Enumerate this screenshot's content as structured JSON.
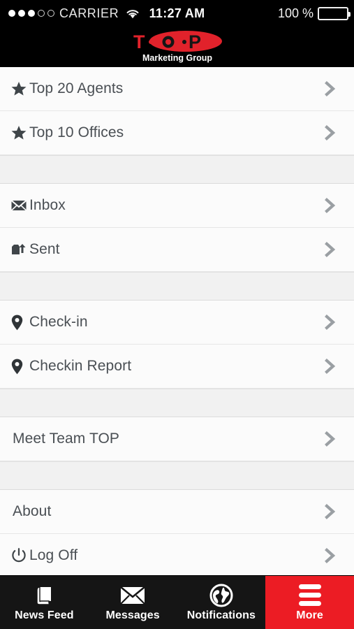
{
  "status_bar": {
    "carrier": "CARRIER",
    "signal_dots_filled": 3,
    "signal_dots_empty": 2,
    "wifi_icon": "wifi-icon",
    "time": "11:27 AM",
    "battery_percent": "100 %",
    "battery_icon": "battery-full-icon"
  },
  "brand": {
    "logo_text": "T·O·P",
    "logo_letters": [
      "T",
      "O",
      "P"
    ],
    "tagline": "Marketing Group",
    "logo_color": "#e1222b",
    "tagline_color": "#ffffff"
  },
  "menu": {
    "sections": [
      {
        "items": [
          {
            "label": "Top 20 Agents",
            "icon": "star-icon",
            "chevron": "chevron-right-icon"
          },
          {
            "label": "Top 10 Offices",
            "icon": "star-icon",
            "chevron": "chevron-right-icon"
          }
        ]
      },
      {
        "items": [
          {
            "label": "Inbox",
            "icon": "envelope-icon",
            "chevron": "chevron-right-icon"
          },
          {
            "label": "Sent",
            "icon": "outbox-upload-icon",
            "chevron": "chevron-right-icon"
          }
        ]
      },
      {
        "items": [
          {
            "label": "Check-in",
            "icon": "map-pin-icon",
            "chevron": "chevron-right-icon"
          },
          {
            "label": "Checkin Report",
            "icon": "map-pin-icon",
            "chevron": "chevron-right-icon"
          }
        ]
      },
      {
        "items": [
          {
            "label": "Meet Team TOP",
            "icon": "",
            "chevron": "chevron-right-icon"
          }
        ]
      },
      {
        "items": [
          {
            "label": "About",
            "icon": "",
            "chevron": "chevron-right-icon"
          },
          {
            "label": "Log Off",
            "icon": "power-icon",
            "chevron": "chevron-right-icon"
          }
        ]
      }
    ]
  },
  "tabbar": {
    "active_color": "#ec1c24",
    "tabs": [
      {
        "label": "News Feed",
        "icon": "book-icon",
        "active": false
      },
      {
        "label": "Messages",
        "icon": "envelope-icon",
        "active": false
      },
      {
        "label": "Notifications",
        "icon": "globe-icon",
        "active": false
      },
      {
        "label": "More",
        "icon": "hamburger-icon",
        "active": true
      }
    ]
  }
}
